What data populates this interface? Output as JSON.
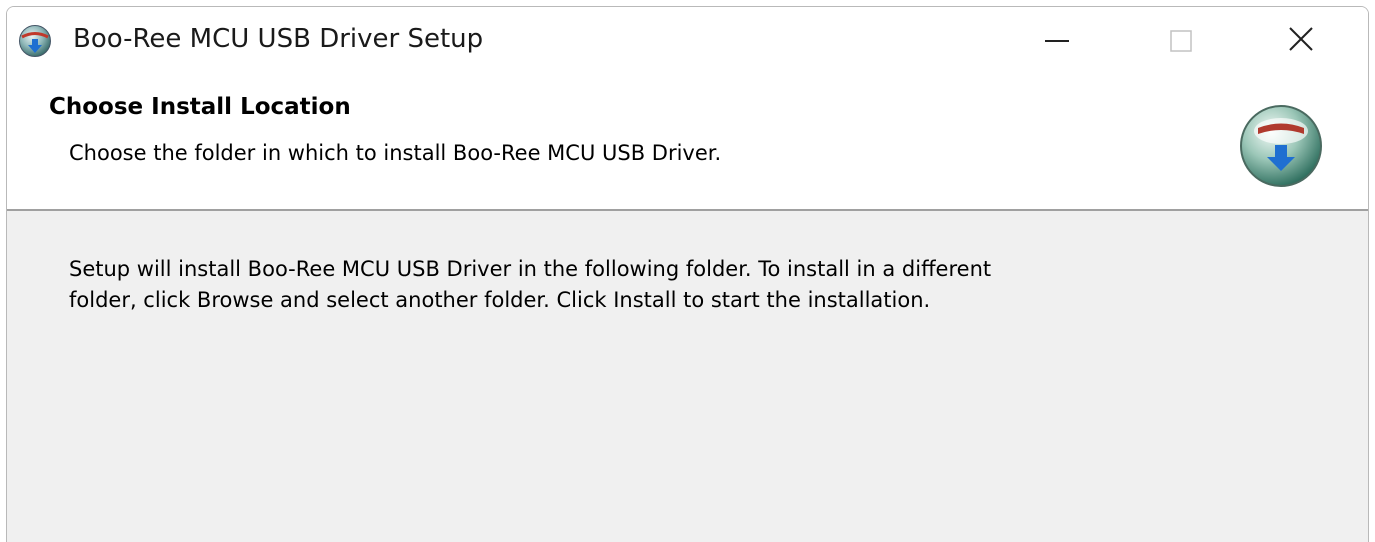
{
  "window": {
    "title": "Boo-Ree MCU USB Driver Setup",
    "app_icon": "installer-globe-icon",
    "controls": [
      "minimize-icon",
      "maximize-icon",
      "close-icon"
    ]
  },
  "header": {
    "title": "Choose Install Location",
    "subtitle": "Choose the folder in which to install Boo-Ree MCU USB Driver.",
    "icon": "installer-globe-icon"
  },
  "body": {
    "description_line1": "Setup will install Boo-Ree MCU USB Driver in the following folder. To install in a different",
    "description_line2": "folder, click Browse and select another folder. Click Install to start the installation."
  },
  "colors": {
    "body_background": "#f0f0f0",
    "header_background": "#ffffff",
    "divider": "#a0a0a0"
  }
}
